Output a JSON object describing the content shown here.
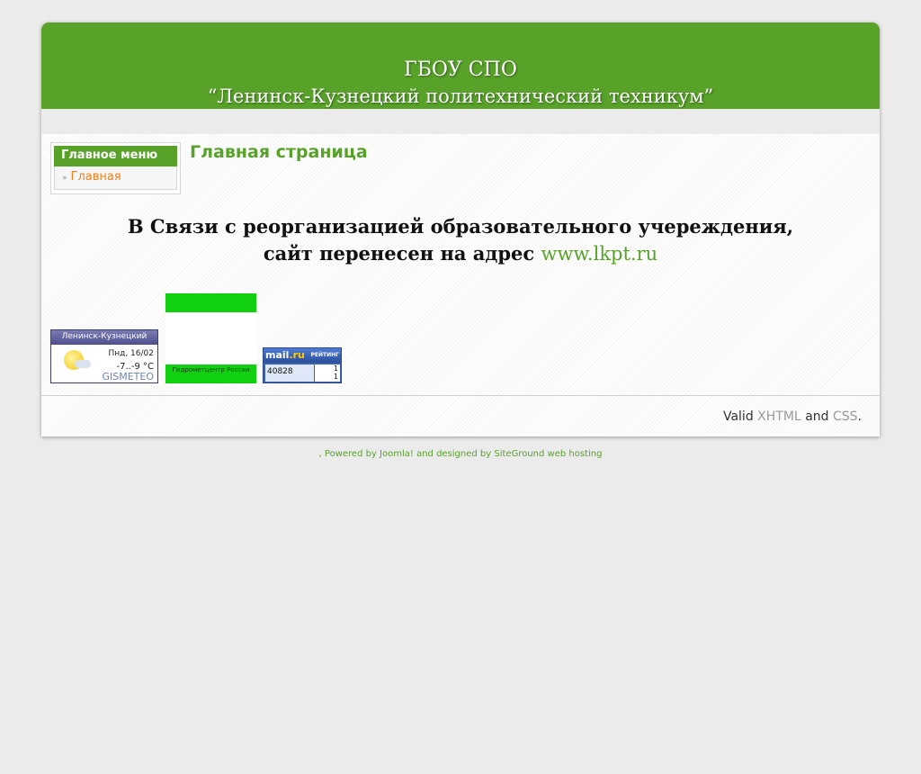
{
  "header": {
    "line1": "ГБОУ СПО",
    "line2": "“Ленинск-Кузнецкий политехнический техникум”"
  },
  "menu": {
    "title": "Главное меню",
    "items": [
      {
        "label": "Главная"
      }
    ]
  },
  "main": {
    "heading": "Главная страница",
    "notice_line1": "В Связи с реорганизацией образовательного учереждения,",
    "notice_line2_text": "сайт перенесен на адрес",
    "notice_link": "www.lkpt.ru"
  },
  "widgets": {
    "gismeteo": {
      "city": "Ленинск-Кузнецкий",
      "date": "Пнд, 16/02",
      "temp": "-7..-9 °C",
      "brand": "GISMETEO"
    },
    "hydromet": {
      "label": "Гидрометцентр России"
    },
    "mailru": {
      "logo_mail": "mail",
      "logo_ru": ".ru",
      "rating_label": "РЕЙТИНГ",
      "count": "40828",
      "side_top": "1",
      "side_bottom": "1"
    }
  },
  "footer": {
    "valid_prefix": "Valid",
    "xhtml": "XHTML",
    "and": "and",
    "css": "CSS",
    "period": "."
  },
  "credits": ", Powered by Joomla! and designed by SiteGround web hosting",
  "colors": {
    "brand_green": "#58a22a",
    "menu_link_orange": "#f07f1d",
    "background": "#ebebeb"
  }
}
